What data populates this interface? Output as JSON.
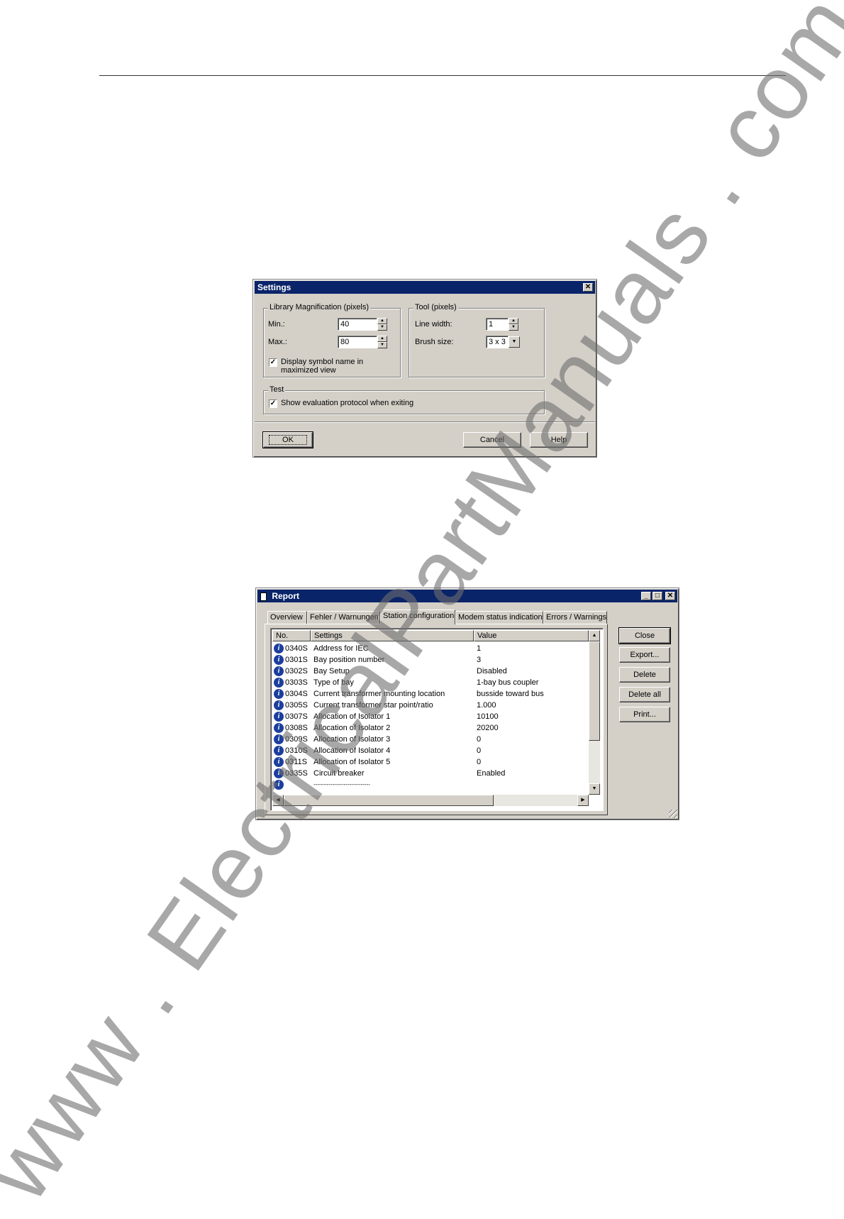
{
  "watermark": "www . ElectricalPartManuals . com",
  "settings": {
    "title": "Settings",
    "library_group": "Library Magnification (pixels)",
    "min_label": "Min.:",
    "min_value": "40",
    "max_label": "Max.:",
    "max_value": "80",
    "display_symbol_line1": "Display symbol name in",
    "display_symbol_line2": "maximized view",
    "tool_group": "Tool (pixels)",
    "line_width_label": "Line width:",
    "line_width_value": "1",
    "brush_size_label": "Brush size:",
    "brush_size_value": "3 x 3",
    "test_group": "Test",
    "show_protocol": "Show evaluation protocol when exiting",
    "ok": "OK",
    "cancel": "Cancel",
    "help": "Help"
  },
  "report": {
    "title": "Report",
    "tabs": [
      {
        "label": "Overview"
      },
      {
        "label": "Fehler / Warnungen"
      },
      {
        "label": "Station configuration"
      },
      {
        "label": "Modem status indications"
      },
      {
        "label": "Errors / Warnings"
      }
    ],
    "columns": {
      "no": "No.",
      "settings": "Settings",
      "value": "Value"
    },
    "rows": [
      {
        "no": "0340S",
        "setting": "Address for IEC",
        "value": "1"
      },
      {
        "no": "0301S",
        "setting": "Bay position number",
        "value": "3"
      },
      {
        "no": "0302S",
        "setting": "Bay Setup",
        "value": "Disabled"
      },
      {
        "no": "0303S",
        "setting": "Type of bay",
        "value": "1-bay bus coupler"
      },
      {
        "no": "0304S",
        "setting": "Current transformer mounting location",
        "value": "busside toward bus"
      },
      {
        "no": "0305S",
        "setting": "Current transformer star point/ratio",
        "value": "1.000"
      },
      {
        "no": "0307S",
        "setting": "Allocation of Isolator 1",
        "value": "10100"
      },
      {
        "no": "0308S",
        "setting": "Allocation of Isolator 2",
        "value": "20200"
      },
      {
        "no": "0309S",
        "setting": "Allocation of Isolator 3",
        "value": "0"
      },
      {
        "no": "0310S",
        "setting": "Allocation of Isolator 4",
        "value": "0"
      },
      {
        "no": "0311S",
        "setting": "Allocation of Isolator 5",
        "value": "0"
      },
      {
        "no": "0335S",
        "setting": "Circuit breaker",
        "value": "Enabled"
      },
      {
        "no": "",
        "setting": "------------------------------",
        "value": ""
      }
    ],
    "buttons": {
      "close": "Close",
      "export": "Export...",
      "delete": "Delete",
      "delete_all": "Delete all",
      "print": "Print..."
    }
  }
}
